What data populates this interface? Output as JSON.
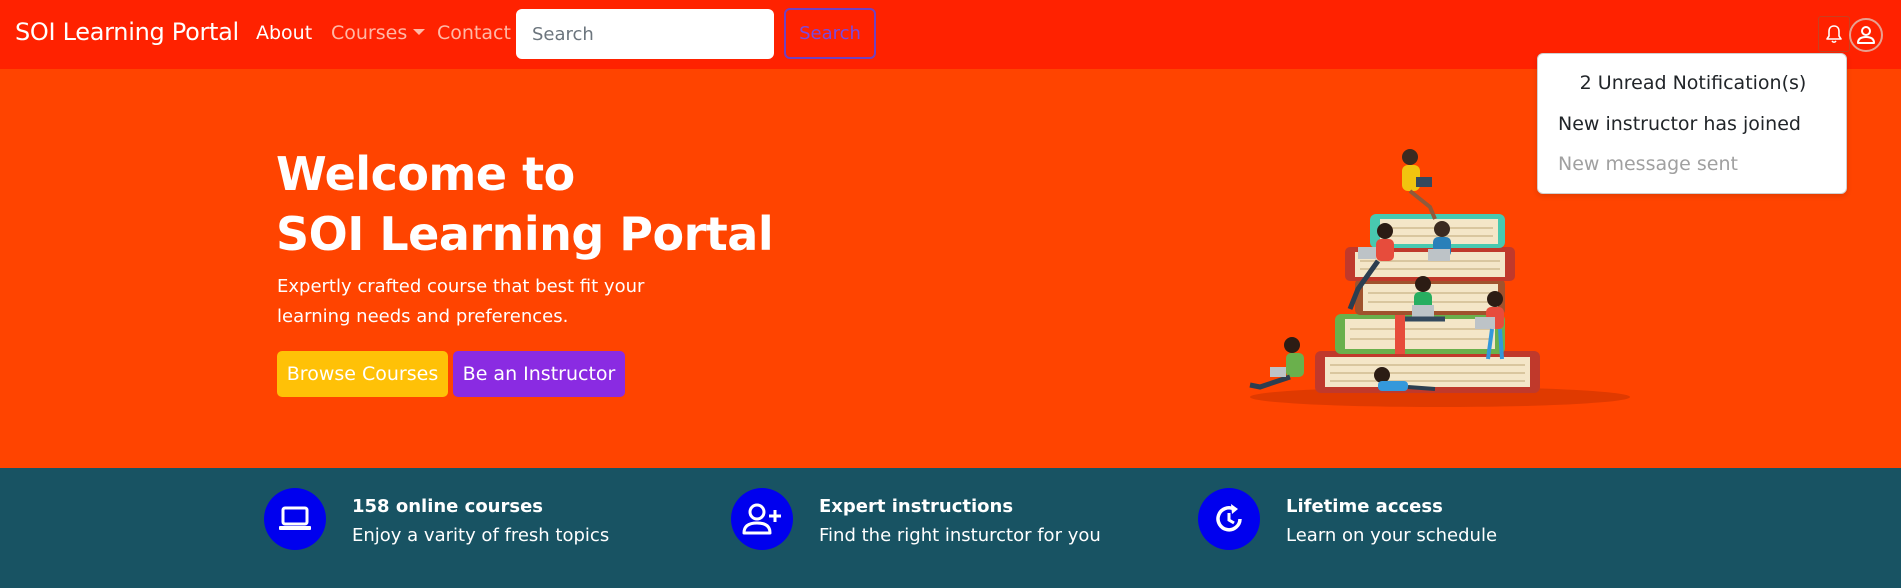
{
  "navbar": {
    "brand": "SOI Learning Portal",
    "links": [
      "About",
      "Courses",
      "Contact"
    ],
    "search_placeholder": "Search",
    "search_button": "Search"
  },
  "notifications": {
    "header": "2 Unread Notification(s)",
    "items": [
      "New instructor has joined",
      "New message sent"
    ]
  },
  "hero": {
    "title_line1": "Welcome to",
    "title_line2": "SOI Learning Portal",
    "subtitle_line1": "Expertly crafted course that best fit your",
    "subtitle_line2": "learning needs and preferences.",
    "browse_button": "Browse Courses",
    "instructor_button": "Be an Instructor"
  },
  "features": [
    {
      "title": "158 online courses",
      "desc": "Enjoy a varity of fresh topics",
      "icon": "laptop-icon"
    },
    {
      "title": "Expert instructions",
      "desc": "Find the right insturctor for you",
      "icon": "user-plus-icon"
    },
    {
      "title": "Lifetime access",
      "desc": "Learn on your schedule",
      "icon": "clock-refresh-icon"
    }
  ],
  "colors": {
    "navbar": "#ff2200",
    "hero": "#ff4400",
    "features": "#185363",
    "feature_icon": "#0000ee",
    "browse": "#ffc107",
    "instructor": "#8a2be2"
  }
}
